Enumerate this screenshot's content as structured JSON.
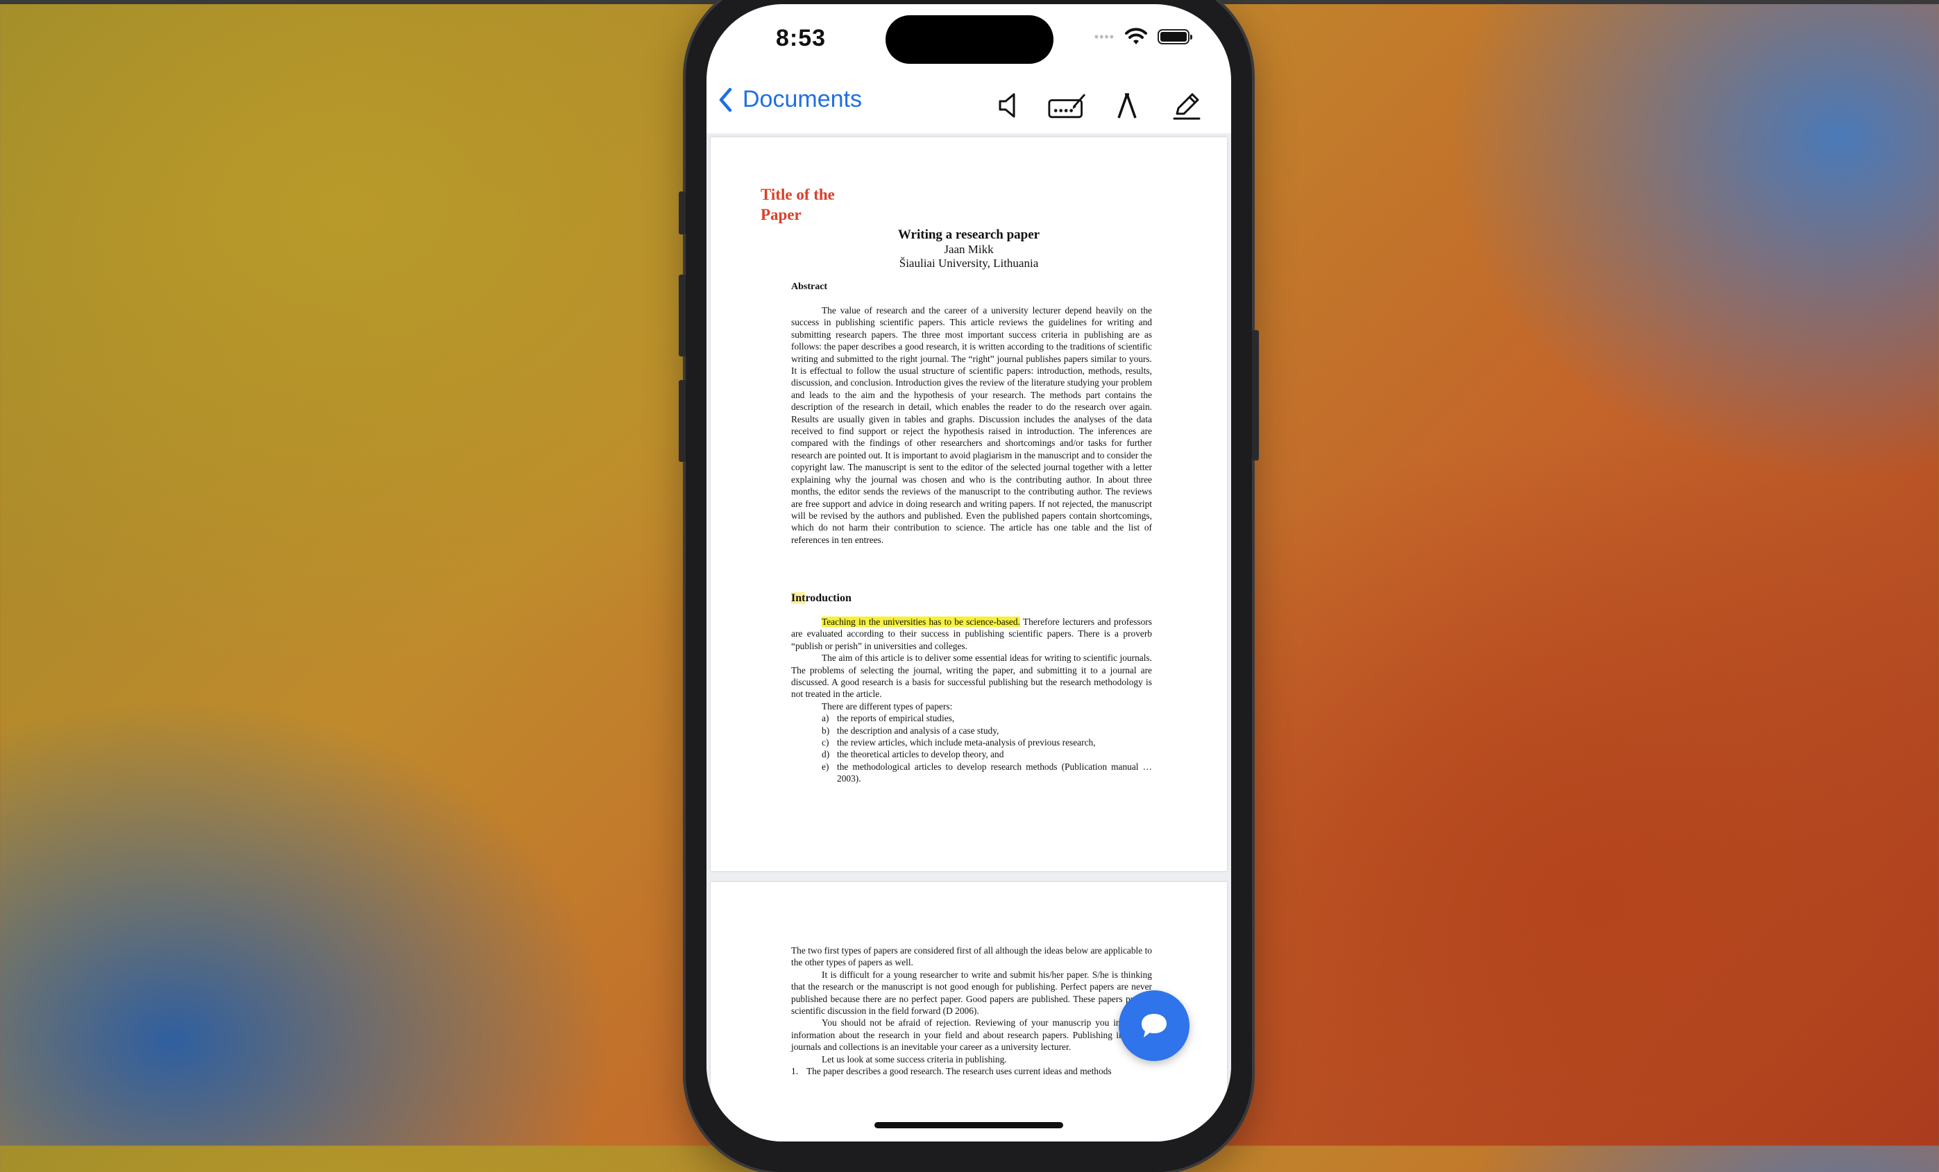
{
  "status_bar": {
    "time": "8:53"
  },
  "navbar": {
    "back_label": "Documents",
    "tools": [
      "speaker-icon",
      "keyboard-pen-icon",
      "text-tool-icon",
      "pencil-icon"
    ]
  },
  "page1": {
    "annotation_title": "Title of the Paper",
    "title": "Writing a research paper",
    "author": "Jaan Mikk",
    "affiliation": "Šiauliai University, Lithuania",
    "abstract_heading": "Abstract",
    "abstract_text": "The value of research and the career of a university lecturer depend heavily on the success in publishing scientific papers. This article reviews the guidelines for writing and submitting research papers. The three most important success criteria in publishing are as follows: the paper describes a good research, it is written according to the traditions of scientific writing and submitted to the right journal. The “right” journal publishes papers similar to yours. It is effectual to follow the usual structure of scientific papers: introduction, methods, results, discussion, and conclusion. Introduction gives the review of the literature studying your problem and leads to the aim and the hypothesis of your research. The methods part contains the description of the research in detail, which enables the reader to do the research over again. Results are usually given in tables and graphs. Discussion includes the analyses of the data received to find support or reject the hypothesis raised in introduction. The inferences are compared with the findings of other researchers and shortcomings and/or tasks for further research are pointed out. It is important to avoid plagiarism in the manuscript and to consider the copyright law. The manuscript is sent to the editor of the selected journal together with a letter explaining why the journal was chosen and who is the contributing author. In about three months, the editor sends the reviews of the manuscript to the contributing author. The reviews are free support and advice in doing research and writing papers. If not rejected, the manuscript will be revised by the authors and published. Even the published papers contain shortcomings, which do not harm their contribution to science. The article has one table and the list of references in ten entrees.",
    "intro_heading_highlighted": "Int",
    "intro_heading_rest": "roduction",
    "intro_highlight": "Teaching in the universities has to be science-based.",
    "intro_p1_rest": " Therefore lecturers and professors are evaluated according to their success in publishing scientific papers. There is a proverb “publish or perish” in universities and colleges.",
    "intro_p2": "The aim of this article is to deliver some essential ideas for writing to scientific journals. The problems of selecting the journal, writing the paper, and submitting it to a journal are discussed. A good research is a basis for successful publishing but the research methodology is not treated in the article.",
    "intro_p3": "There are different types of papers:",
    "types": [
      {
        "label": "a)",
        "text": "the reports of empirical studies,"
      },
      {
        "label": "b)",
        "text": "the description and analysis of a case study,"
      },
      {
        "label": "c)",
        "text": "the review articles, which include meta-analysis of previous research,"
      },
      {
        "label": "d)",
        "text": "the theoretical articles to develop theory, and"
      },
      {
        "label": "e)",
        "text": "the methodological articles to develop research methods (Publication manual … 2003)."
      }
    ]
  },
  "page2": {
    "p1": "The two first types of papers are considered first of all although the ideas below are applicable to the other types of papers as well.",
    "p2": "It is difficult for a young researcher to write and submit his/her paper. S/he is thinking that the research or the manuscript is not good enough for publishing. Perfect papers are never published because there are no perfect paper. Good papers are published. These papers put the scientific discussion in the field forward (D 2006).",
    "p3": "You should not be afraid of rejection. Reviewing of your manuscrip you invaluable information about the research in your field and about research papers. Publishing in valued journals and collections is an inevitable your career as a university lecturer.",
    "p4": "Let us look at some success criteria in publishing.",
    "item1_label": "1.",
    "item1_text": "The paper describes a good research. The research uses current ideas and methods"
  },
  "fab_icon": "chat-bubble-icon"
}
